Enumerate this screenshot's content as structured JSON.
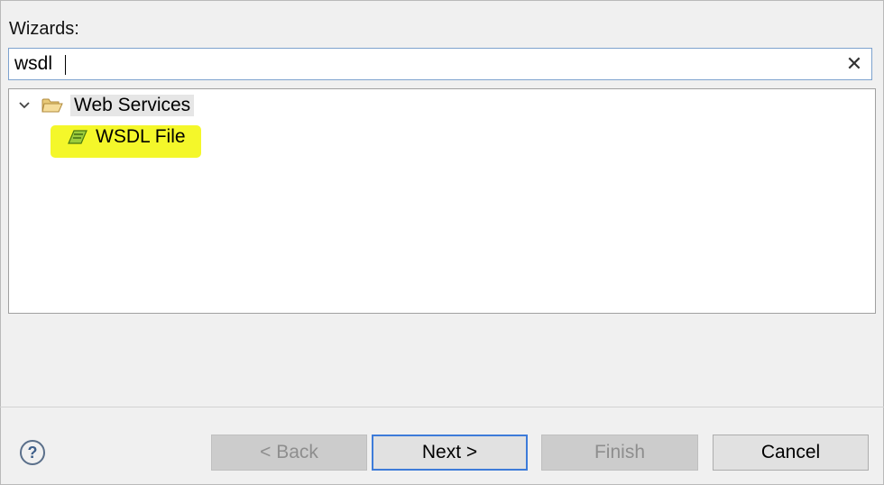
{
  "labels": {
    "wizards": "Wizards:"
  },
  "filter": {
    "value": "wsdl",
    "clear_glyph": "✕"
  },
  "tree": {
    "items": [
      {
        "label": "Web Services",
        "icon": "folder-open-icon",
        "expanded": true
      },
      {
        "label": "WSDL File",
        "icon": "wsdl-file-icon",
        "highlighted": true
      }
    ]
  },
  "buttons": {
    "back": "< Back",
    "next": "Next >",
    "finish": "Finish",
    "cancel": "Cancel"
  },
  "help": {
    "glyph": "?"
  },
  "colors": {
    "highlight": "#f4f72a",
    "focus_border": "#3d7bd9",
    "disabled_text": "#8e8e8e"
  }
}
